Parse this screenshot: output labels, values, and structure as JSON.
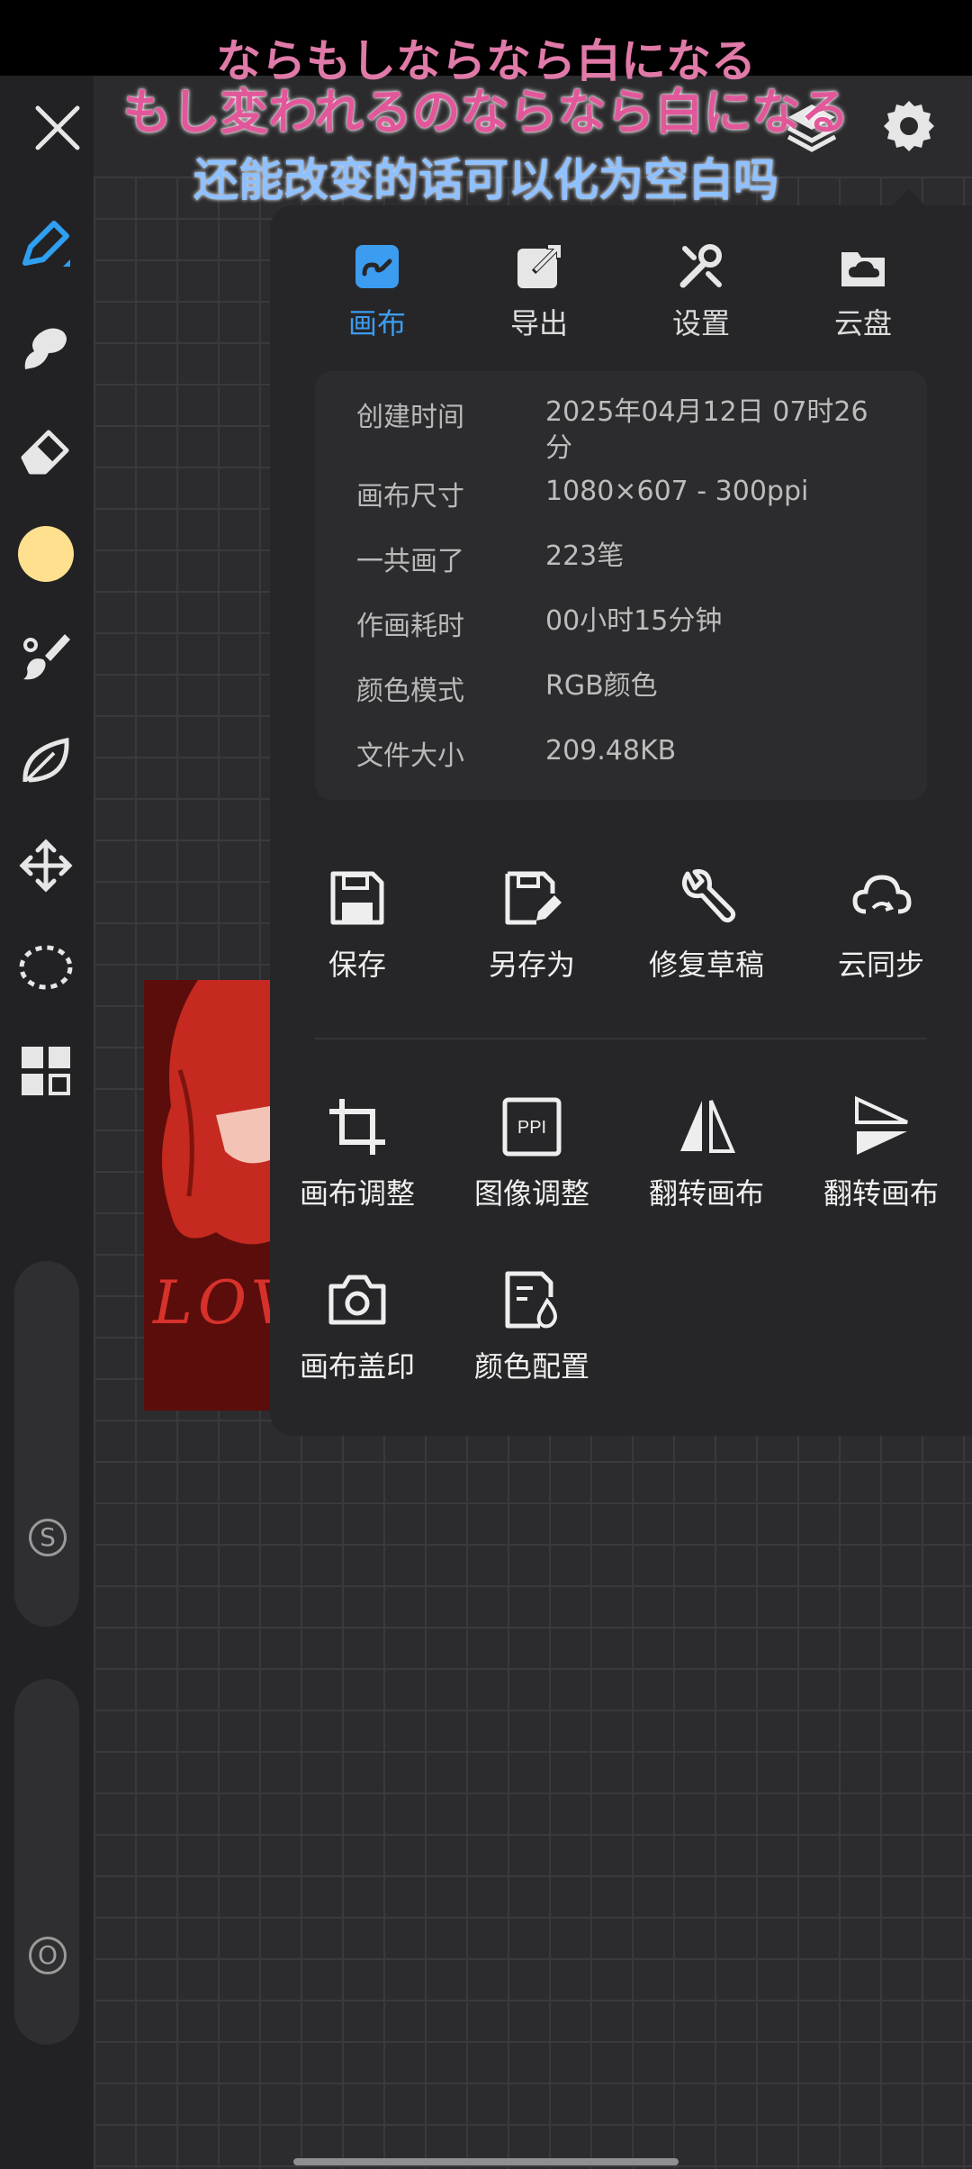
{
  "lyrics": {
    "line_top": "ならもしならなら白になる",
    "line_jp": "もし変われるのならなら白になる",
    "line_cn": "还能改变的话可以化为空白吗"
  },
  "header": {
    "close_icon": "close-icon",
    "layers_icon": "layers-icon",
    "settings_icon": "gear-icon"
  },
  "sidebar": {
    "tools": [
      "pen-icon",
      "smudge-icon",
      "eraser-icon",
      "color-swatch",
      "brush-icon",
      "leaf-icon",
      "move-icon",
      "lasso-icon",
      "grid-icon"
    ],
    "color": "#ffe08e",
    "slider1_label": "S",
    "slider2_label": "O"
  },
  "artwork": {
    "text": "LOVE"
  },
  "panel": {
    "tabs": [
      {
        "label": "画布",
        "icon": "canvas-icon"
      },
      {
        "label": "导出",
        "icon": "export-icon"
      },
      {
        "label": "设置",
        "icon": "tools-icon"
      },
      {
        "label": "云盘",
        "icon": "cloud-folder-icon"
      }
    ],
    "info": [
      {
        "key": "创建时间",
        "value": "2025年04月12日 07时26分"
      },
      {
        "key": "画布尺寸",
        "value": "1080×607 - 300ppi"
      },
      {
        "key": "一共画了",
        "value": "223笔"
      },
      {
        "key": "作画耗时",
        "value": "00小时15分钟"
      },
      {
        "key": "颜色模式",
        "value": "RGB颜色"
      },
      {
        "key": "文件大小",
        "value": "209.48KB"
      }
    ],
    "actions_row1": [
      {
        "label": "保存",
        "icon": "save-icon"
      },
      {
        "label": "另存为",
        "icon": "save-as-icon"
      },
      {
        "label": "修复草稿",
        "icon": "wrench-icon"
      },
      {
        "label": "云同步",
        "icon": "cloud-sync-icon"
      }
    ],
    "actions_row2": [
      {
        "label": "画布调整",
        "icon": "crop-icon"
      },
      {
        "label": "图像调整",
        "icon": "ppi-icon"
      },
      {
        "label": "翻转画布",
        "icon": "flip-horizontal-icon"
      },
      {
        "label": "翻转画布",
        "icon": "flip-vertical-icon"
      }
    ],
    "actions_row3": [
      {
        "label": "画布盖印",
        "icon": "camera-icon"
      },
      {
        "label": "颜色配置",
        "icon": "color-profile-icon"
      }
    ],
    "ppi_text": "PPI",
    "accent": "#3c9cf0"
  }
}
